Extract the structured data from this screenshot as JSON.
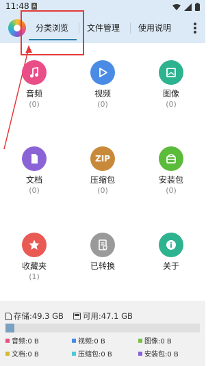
{
  "statusbar": {
    "time": "11:48",
    "notification_glyph": "A"
  },
  "toolbar": {
    "tabs": [
      {
        "label": "分类浏览",
        "active": true
      },
      {
        "label": "文件管理",
        "active": false
      },
      {
        "label": "使用说明",
        "active": false
      }
    ]
  },
  "categories": [
    {
      "label": "音频",
      "count": "(0)",
      "color": "#e94e87",
      "icon": "music-note-icon"
    },
    {
      "label": "视频",
      "count": "(0)",
      "color": "#4a8be6",
      "icon": "play-icon"
    },
    {
      "label": "图像",
      "count": "(0)",
      "color": "#2db38f",
      "icon": "image-icon"
    },
    {
      "label": "文档",
      "count": "(0)",
      "color": "#8a64d6",
      "icon": "document-icon"
    },
    {
      "label": "压缩包",
      "count": "(0)",
      "color": "#c88a3a",
      "icon": "zip-icon",
      "glyph": "ZIP"
    },
    {
      "label": "安装包",
      "count": "(0)",
      "color": "#5bbb3a",
      "icon": "android-icon"
    },
    {
      "label": "收藏夹",
      "count": "(1)",
      "color": "#ea5a54",
      "icon": "star-icon"
    },
    {
      "label": "已转换",
      "count": "",
      "color": "#9a9a9a",
      "icon": "convert-icon"
    },
    {
      "label": "关于",
      "count": "",
      "color": "#2db38f",
      "icon": "info-icon"
    }
  ],
  "storage": {
    "total_label": "存储:49.3 GB",
    "free_label": "可用:47.1 GB",
    "used_fraction": 0.045,
    "legend": [
      {
        "label": "音频:0 B",
        "color": "#e94e87"
      },
      {
        "label": "视频:0 B",
        "color": "#4a8be6"
      },
      {
        "label": "图像:0 B",
        "color": "#7bc043"
      },
      {
        "label": "文档:0 B",
        "color": "#d6b83a"
      },
      {
        "label": "压缩包:0 B",
        "color": "#4ec9d6"
      },
      {
        "label": "安装包:0 B",
        "color": "#8a64d6"
      }
    ]
  }
}
